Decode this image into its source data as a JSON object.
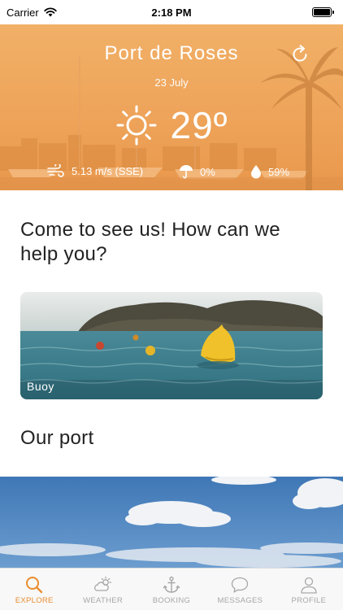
{
  "status_bar": {
    "carrier": "Carrier",
    "time": "2:18 PM",
    "battery_level": 1.0
  },
  "weather": {
    "location": "Port de Roses",
    "date": "23 July",
    "temperature": "29º",
    "condition_icon": "sun-icon",
    "wind": "5.13 m/s (SSE)",
    "rain": "0%",
    "humidity": "59%",
    "refresh_icon": "refresh-icon"
  },
  "main": {
    "heading_help": "Come to see us! How can we help you?",
    "featured_card": {
      "label": "Buoy"
    },
    "heading_port": "Our port"
  },
  "tabbar": {
    "active": "explore",
    "tabs": [
      {
        "id": "explore",
        "label": "EXPLORE",
        "icon": "search-icon"
      },
      {
        "id": "weather",
        "label": "WEATHER",
        "icon": "cloud-sun-icon"
      },
      {
        "id": "booking",
        "label": "BOOKING",
        "icon": "anchor-icon"
      },
      {
        "id": "messages",
        "label": "MESSAGES",
        "icon": "chat-bubble-icon"
      },
      {
        "id": "profile",
        "label": "PROFILE",
        "icon": "user-icon"
      }
    ]
  },
  "colors": {
    "accent": "#e98d2f",
    "header_tint": "#eea45a",
    "tab_inactive": "#a7a7a7"
  }
}
